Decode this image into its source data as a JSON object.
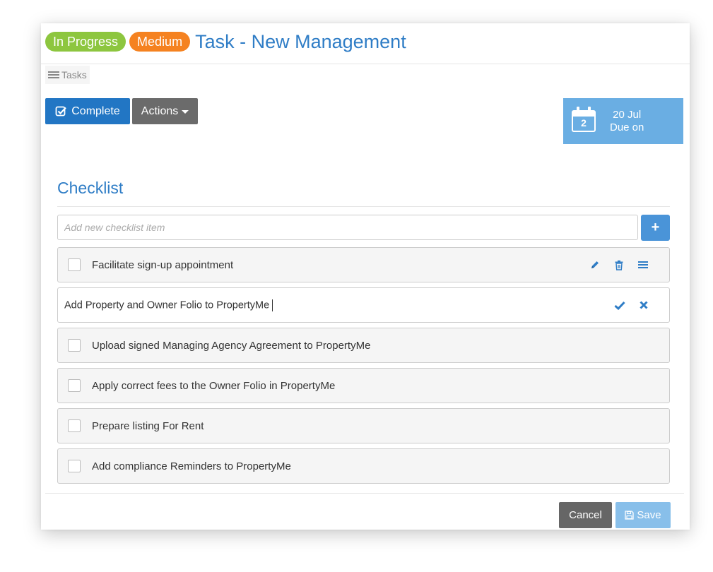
{
  "header": {
    "status_badge": "In Progress",
    "priority_badge": "Medium",
    "title": "Task - New Management"
  },
  "breadcrumb": {
    "label": "Tasks",
    "icon": "list-icon"
  },
  "toolbar": {
    "complete_label": "Complete",
    "actions_label": "Actions"
  },
  "due": {
    "calendar_day": "2",
    "date": "20 Jul",
    "label": "Due on"
  },
  "checklist": {
    "title": "Checklist",
    "input_placeholder": "Add new checklist item",
    "add_button": "+",
    "items": [
      {
        "label": "Facilitate sign-up appointment",
        "checked": false
      },
      {
        "label": "Add Property and Owner Folio to PropertyMe",
        "editing": true
      },
      {
        "label": "Upload signed Managing Agency Agreement to PropertyMe",
        "checked": false
      },
      {
        "label": "Apply correct fees to the Owner Folio in PropertyMe",
        "checked": false
      },
      {
        "label": "Prepare listing For Rent",
        "checked": false
      },
      {
        "label": "Add compliance Reminders to PropertyMe",
        "checked": false
      }
    ]
  },
  "footer": {
    "cancel_label": "Cancel",
    "save_label": "Save"
  },
  "colors": {
    "accent": "#2f7dc6",
    "status_green": "#8dc63f",
    "priority_orange": "#f58220",
    "primary_button": "#2276c4",
    "due_box": "#6aaee3"
  }
}
